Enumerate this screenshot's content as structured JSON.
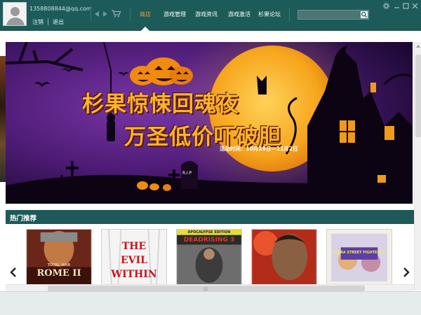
{
  "header": {
    "user_email": "1358808844@qq.com",
    "logout_account_label": "注销",
    "exit_label": "退出",
    "search_placeholder": "",
    "tabs": [
      {
        "label": "商店",
        "active": true
      },
      {
        "label": "游戏管理",
        "active": false
      },
      {
        "label": "游戏资讯",
        "active": false
      },
      {
        "label": "游戏激活",
        "active": false
      },
      {
        "label": "杉果论坛",
        "active": false
      }
    ],
    "colors": {
      "bar": "#1c5b5a",
      "active_tab": "#f39a3c"
    }
  },
  "banner": {
    "title_line1": "杉果惊悚回魂夜",
    "title_line2": "万圣低价吓破胆",
    "date_text": "活动时间：10月29日—11月2日",
    "gravestone_text": "R.I.P",
    "colors": {
      "sky": "#3a1258",
      "moon": "#f4a21a",
      "title": "#ffb22a"
    }
  },
  "hot_section": {
    "title": "热门推荐",
    "games": [
      {
        "cover_lines": [
          "TOTAL WAR",
          "ROME II"
        ],
        "icon": "rome-cover"
      },
      {
        "cover_lines": [
          "THE",
          "EVIL",
          "WITHIN"
        ],
        "icon": "evil-within-cover"
      },
      {
        "cover_lines": [
          "APOCALYPSE EDITION",
          "DEADRISING 3"
        ],
        "icon": "deadrising-cover"
      },
      {
        "cover_lines": [],
        "icon": "fighter-cover"
      },
      {
        "cover_lines": [
          "ULTRA STREET FIGHTER IV"
        ],
        "icon": "street-fighter-cover"
      }
    ]
  }
}
